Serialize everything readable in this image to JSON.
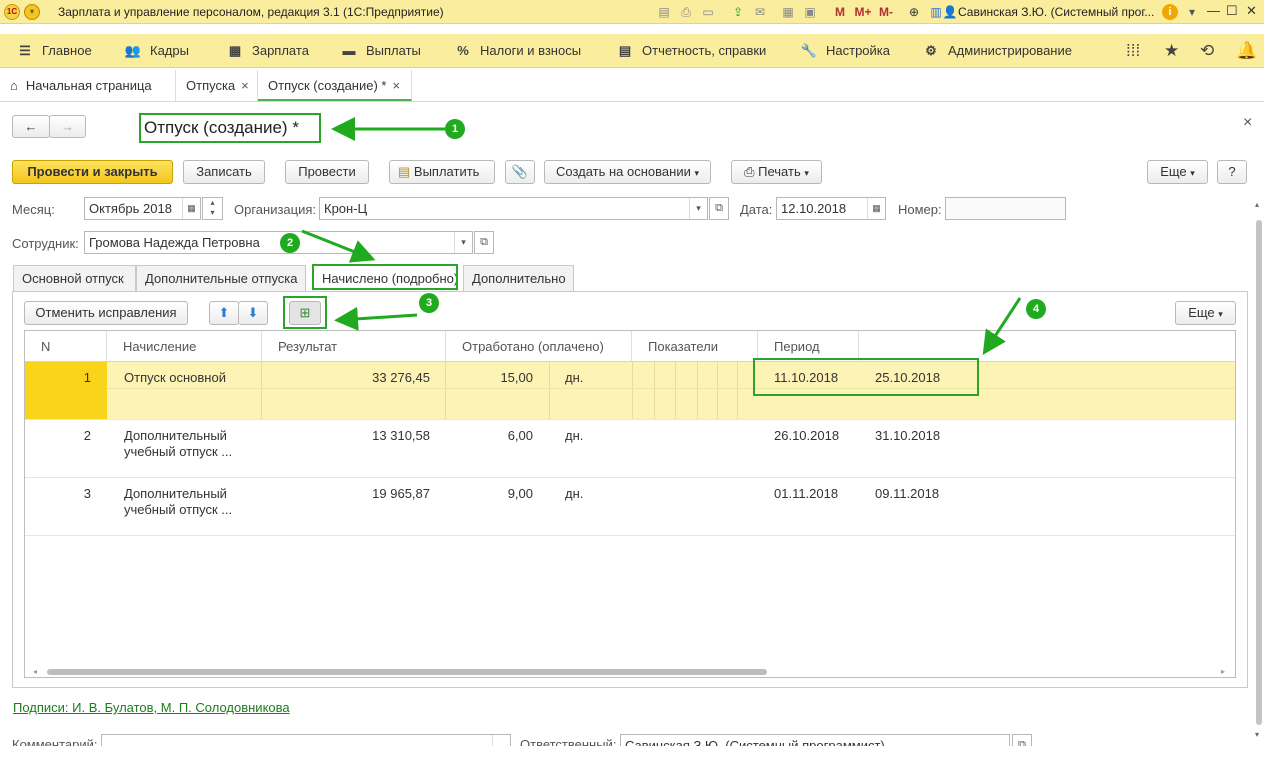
{
  "window": {
    "title": "Зарплата и управление персоналом, редакция 3.1  (1С:Предприятие)",
    "user": "Савинская З.Ю. (Системный прог...",
    "toolbar_m": "M",
    "toolbar_mplus": "M+",
    "toolbar_mminus": "M-"
  },
  "menu": {
    "items": [
      "Главное",
      "Кадры",
      "Зарплата",
      "Выплаты",
      "Налоги и взносы",
      "Отчетность, справки",
      "Настройка",
      "Администрирование"
    ],
    "icons": [
      "hamburger-icon",
      "people-icon",
      "calculator-icon",
      "cash-icon",
      "percent-icon",
      "report-icon",
      "wrench-icon",
      "gear-icon"
    ]
  },
  "tabs": [
    {
      "label": "Начальная страница",
      "active": false
    },
    {
      "label": "Отпуска",
      "active": false
    },
    {
      "label": "Отпуск (создание) *",
      "active": true
    }
  ],
  "document": {
    "title": "Отпуск (создание) *"
  },
  "buttons": {
    "post_close": "Провести и закрыть",
    "save": "Записать",
    "post": "Провести",
    "pay": "Выплатить",
    "create_based": "Создать на основании",
    "print": "Печать",
    "more": "Еще",
    "help": "?",
    "cancel_corrections": "Отменить исправления",
    "more2": "Еще"
  },
  "form": {
    "month_label": "Месяц:",
    "month_value": "Октябрь 2018",
    "org_label": "Организация:",
    "org_value": "Крон-Ц",
    "date_label": "Дата:",
    "date_value": "12.10.2018",
    "number_label": "Номер:",
    "number_value": "",
    "employee_label": "Сотрудник:",
    "employee_value": "Громова Надежда Петровна"
  },
  "doc_tabs": [
    {
      "label": "Основной отпуск",
      "active": false
    },
    {
      "label": "Дополнительные отпуска",
      "active": false
    },
    {
      "label": "Начислено (подробно)",
      "active": true
    },
    {
      "label": "Дополнительно",
      "active": false
    }
  ],
  "table": {
    "headers": [
      "N",
      "Начисление",
      "Результат",
      "Отработано (оплачено)",
      "Показатели",
      "Период"
    ],
    "rows": [
      {
        "n": "1",
        "name_line1": "Отпуск основной",
        "name_line2": "",
        "result": "33 276,45",
        "worked": "15,00",
        "unit": "дн.",
        "from": "11.10.2018",
        "to": "25.10.2018",
        "selected": true
      },
      {
        "n": "2",
        "name_line1": "Дополнительный",
        "name_line2": "учебный отпуск ...",
        "result": "13 310,58",
        "worked": "6,00",
        "unit": "дн.",
        "from": "26.10.2018",
        "to": "31.10.2018",
        "selected": false
      },
      {
        "n": "3",
        "name_line1": "Дополнительный",
        "name_line2": "учебный отпуск ...",
        "result": "19 965,87",
        "worked": "9,00",
        "unit": "дн.",
        "from": "01.11.2018",
        "to": "09.11.2018",
        "selected": false
      }
    ]
  },
  "footer": {
    "signatures": "Подписи: И. В. Булатов, М. П. Солодовникова",
    "comment_label": "Комментарий:",
    "responsible_label": "Ответственный:",
    "responsible_value": "Савинская З.Ю. (Системный программист)"
  },
  "annotations": [
    "1",
    "2",
    "3",
    "4"
  ],
  "colors": {
    "accent_green": "#1faa1f",
    "menu_bg": "#fbed9e",
    "primary_button": "#f3c61e",
    "selected_row": "#fcf3b4"
  }
}
